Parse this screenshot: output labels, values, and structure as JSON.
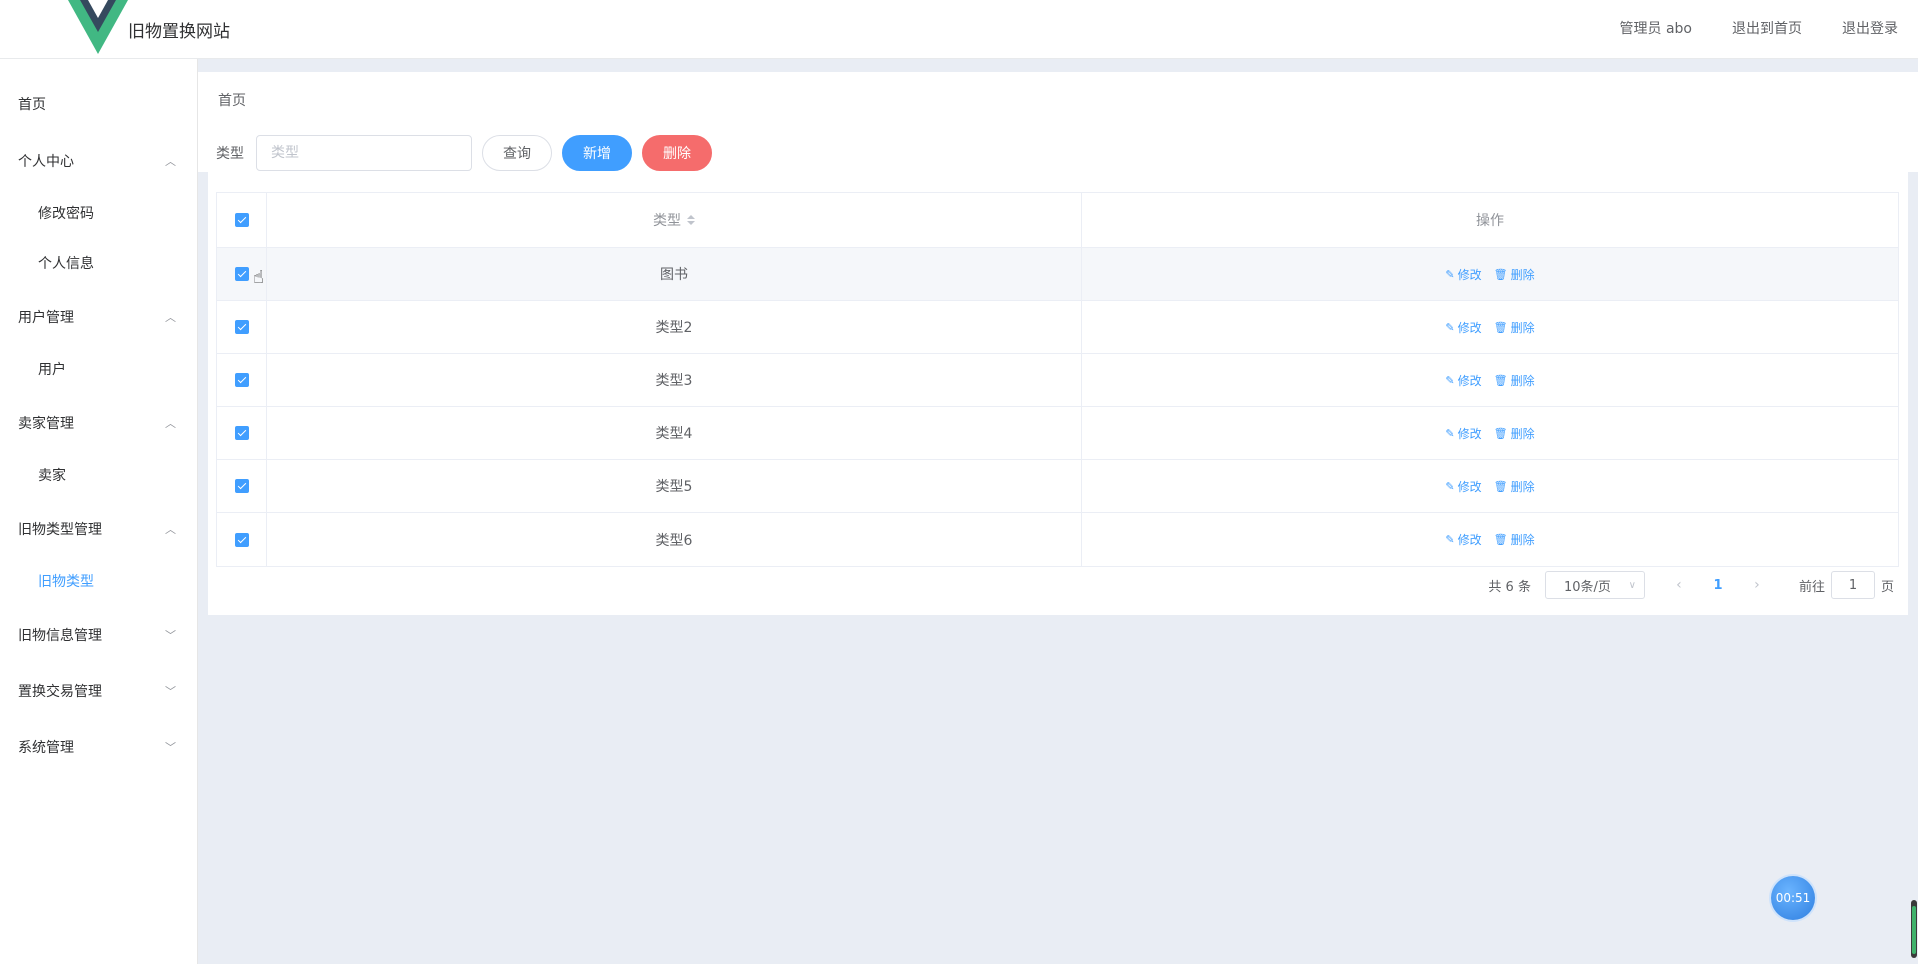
{
  "header": {
    "site_title": "旧物置换网站",
    "links": [
      "管理员 abo",
      "退出到首页",
      "退出登录"
    ]
  },
  "sidebar": {
    "items": [
      {
        "label": "首页",
        "level": 1
      },
      {
        "label": "个人中心",
        "level": 1,
        "expanded": true
      },
      {
        "label": "修改密码",
        "level": 2
      },
      {
        "label": "个人信息",
        "level": 2
      },
      {
        "label": "用户管理",
        "level": 1,
        "expanded": true
      },
      {
        "label": "用户",
        "level": 2
      },
      {
        "label": "卖家管理",
        "level": 1,
        "expanded": true
      },
      {
        "label": "卖家",
        "level": 2
      },
      {
        "label": "旧物类型管理",
        "level": 1,
        "expanded": true
      },
      {
        "label": "旧物类型",
        "level": 2,
        "active": true
      },
      {
        "label": "旧物信息管理",
        "level": 1,
        "expanded": false
      },
      {
        "label": "置换交易管理",
        "level": 1,
        "expanded": false
      },
      {
        "label": "系统管理",
        "level": 1,
        "expanded": false
      }
    ]
  },
  "breadcrumb": "首页",
  "search": {
    "label": "类型",
    "placeholder": "类型",
    "value": "",
    "query_btn": "查询",
    "add_btn": "新增",
    "delete_btn": "删除"
  },
  "table": {
    "headers": [
      "类型",
      "操作"
    ],
    "rows": [
      {
        "type": "图书",
        "checked": true
      },
      {
        "type": "类型2",
        "checked": true
      },
      {
        "type": "类型3",
        "checked": true
      },
      {
        "type": "类型4",
        "checked": true
      },
      {
        "type": "类型5",
        "checked": true
      },
      {
        "type": "类型6",
        "checked": true
      }
    ],
    "edit_label": "修改",
    "delete_label": "删除"
  },
  "pagination": {
    "total_text": "共 6 条",
    "page_size": "10条/页",
    "current_page": "1",
    "jump_prefix": "前往",
    "jump_value": "1",
    "jump_suffix": "页"
  },
  "timer": "00:51",
  "colors": {
    "primary": "#409eff",
    "danger": "#f56c6c",
    "main_bg": "#e9edf4"
  }
}
